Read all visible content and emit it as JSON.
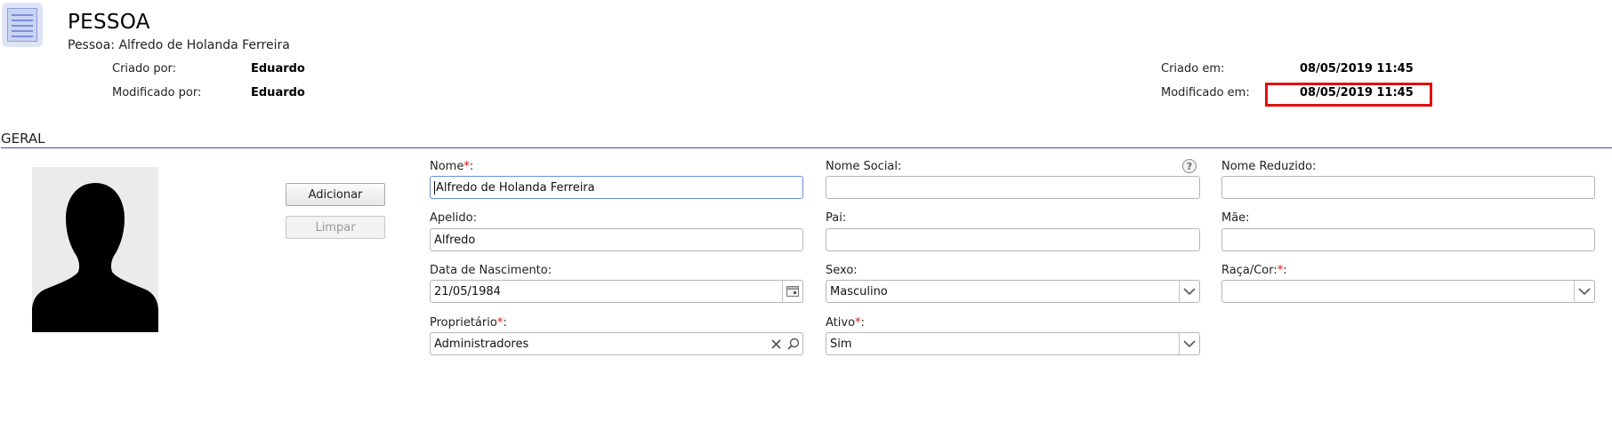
{
  "header": {
    "title": "PESSOA",
    "subtitle": "Pessoa: Alfredo de Holanda Ferreira",
    "created_by_label": "Criado por:",
    "created_by_value": "Eduardo",
    "modified_by_label": "Modificado por:",
    "modified_by_value": "Eduardo",
    "created_on_label": "Criado em:",
    "created_on_value": "08/05/2019 11:45",
    "modified_on_label": "Modificado em:",
    "modified_on_value": "08/05/2019 11:45",
    "highlight_color": "#e01010"
  },
  "section": {
    "title": "GERAL",
    "line_color": "#4b4bb3"
  },
  "photo": {
    "add_label": "Adicionar",
    "clear_label": "Limpar"
  },
  "fields": {
    "nome": {
      "label": "Nome",
      "required_mark": "*",
      "suffix": ":",
      "value": "Alfredo de Holanda Ferreira"
    },
    "nome_social": {
      "label": "Nome Social:",
      "value": "",
      "help": "?"
    },
    "nome_reduzido": {
      "label": "Nome Reduzido:",
      "value": ""
    },
    "apelido": {
      "label": "Apelido:",
      "value": "Alfredo"
    },
    "pai": {
      "label": "Pai:",
      "value": ""
    },
    "mae": {
      "label": "Mãe:",
      "value": ""
    },
    "data_nascimento": {
      "label": "Data de Nascimento:",
      "value": "21/05/1984"
    },
    "sexo": {
      "label": "Sexo:",
      "value": "Masculino"
    },
    "raca_cor": {
      "label": "Raça/Cor:",
      "required_mark": "*",
      "suffix": ":",
      "value": ""
    },
    "proprietario": {
      "label": "Proprietário",
      "required_mark": "*",
      "suffix": ":",
      "value": "Administradores"
    },
    "ativo": {
      "label": "Ativo",
      "required_mark": "*",
      "suffix": ":",
      "value": "Sim"
    }
  }
}
